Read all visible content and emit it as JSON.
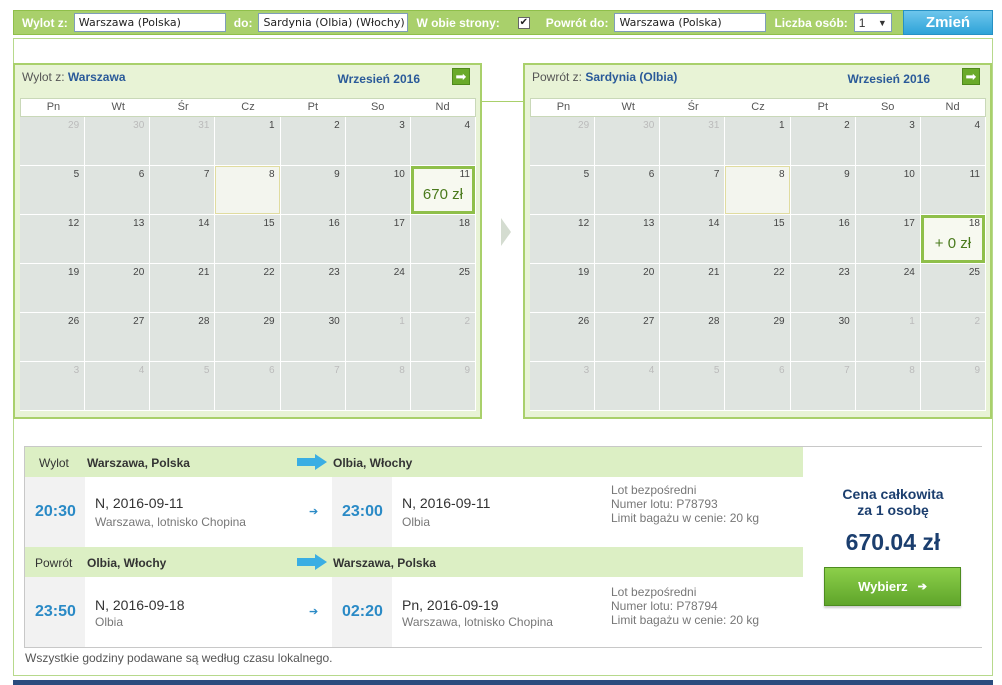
{
  "search": {
    "from_label": "Wylot z:",
    "from_value": "Warszawa (Polska)",
    "to_label": "do:",
    "to_value": "Sardynia (Olbia) (Włochy)",
    "both_ways_label": "W obie strony:",
    "both_ways_checked": "✔",
    "return_label": "Powrót do:",
    "return_value": "Warszawa (Polska)",
    "persons_label": "Liczba osób:",
    "persons_value": "1",
    "submit_label": "Zmień"
  },
  "weekdays": [
    "Pn",
    "Wt",
    "Śr",
    "Cz",
    "Pt",
    "So",
    "Nd"
  ],
  "outbound_calendar": {
    "title_prefix": "Wylot z:",
    "title_city": "Warszawa",
    "month": "Wrzesień 2016",
    "next_icon": "arrow-right-icon",
    "days": [
      {
        "n": "29",
        "muted": true
      },
      {
        "n": "30",
        "muted": true
      },
      {
        "n": "31",
        "muted": true
      },
      {
        "n": "1"
      },
      {
        "n": "2"
      },
      {
        "n": "3"
      },
      {
        "n": "4"
      },
      {
        "n": "5"
      },
      {
        "n": "6"
      },
      {
        "n": "7"
      },
      {
        "n": "8",
        "today": true
      },
      {
        "n": "9"
      },
      {
        "n": "10"
      },
      {
        "n": "11",
        "selected": true,
        "price": "670 zł"
      },
      {
        "n": "12"
      },
      {
        "n": "13"
      },
      {
        "n": "14"
      },
      {
        "n": "15"
      },
      {
        "n": "16"
      },
      {
        "n": "17"
      },
      {
        "n": "18"
      },
      {
        "n": "19"
      },
      {
        "n": "20"
      },
      {
        "n": "21"
      },
      {
        "n": "22"
      },
      {
        "n": "23"
      },
      {
        "n": "24"
      },
      {
        "n": "25"
      },
      {
        "n": "26"
      },
      {
        "n": "27"
      },
      {
        "n": "28"
      },
      {
        "n": "29"
      },
      {
        "n": "30"
      },
      {
        "n": "1",
        "muted": true
      },
      {
        "n": "2",
        "muted": true
      },
      {
        "n": "3",
        "muted": true
      },
      {
        "n": "4",
        "muted": true
      },
      {
        "n": "5",
        "muted": true
      },
      {
        "n": "6",
        "muted": true
      },
      {
        "n": "7",
        "muted": true
      },
      {
        "n": "8",
        "muted": true
      },
      {
        "n": "9",
        "muted": true
      }
    ]
  },
  "return_calendar": {
    "title_prefix": "Powrót z:",
    "title_city": "Sardynia (Olbia)",
    "month": "Wrzesień 2016",
    "next_icon": "arrow-right-icon",
    "days": [
      {
        "n": "29",
        "muted": true
      },
      {
        "n": "30",
        "muted": true
      },
      {
        "n": "31",
        "muted": true
      },
      {
        "n": "1"
      },
      {
        "n": "2"
      },
      {
        "n": "3"
      },
      {
        "n": "4"
      },
      {
        "n": "5"
      },
      {
        "n": "6"
      },
      {
        "n": "7"
      },
      {
        "n": "8",
        "today": true
      },
      {
        "n": "9"
      },
      {
        "n": "10"
      },
      {
        "n": "11"
      },
      {
        "n": "12"
      },
      {
        "n": "13"
      },
      {
        "n": "14"
      },
      {
        "n": "15"
      },
      {
        "n": "16"
      },
      {
        "n": "17"
      },
      {
        "n": "18",
        "selected": true,
        "price": "+ 0 zł"
      },
      {
        "n": "19"
      },
      {
        "n": "20"
      },
      {
        "n": "21"
      },
      {
        "n": "22"
      },
      {
        "n": "23"
      },
      {
        "n": "24"
      },
      {
        "n": "25"
      },
      {
        "n": "26"
      },
      {
        "n": "27"
      },
      {
        "n": "28"
      },
      {
        "n": "29"
      },
      {
        "n": "30"
      },
      {
        "n": "1",
        "muted": true
      },
      {
        "n": "2",
        "muted": true
      },
      {
        "n": "3",
        "muted": true
      },
      {
        "n": "4",
        "muted": true
      },
      {
        "n": "5",
        "muted": true
      },
      {
        "n": "6",
        "muted": true
      },
      {
        "n": "7",
        "muted": true
      },
      {
        "n": "8",
        "muted": true
      },
      {
        "n": "9",
        "muted": true
      }
    ]
  },
  "outbound": {
    "label": "Wylot",
    "from": "Warszawa, Polska",
    "to": "Olbia, Włochy",
    "dep_time": "20:30",
    "dep_day": "N,",
    "dep_date": "2016-09-11",
    "dep_airport": "Warszawa, lotnisko Chopina",
    "arr_time": "23:00",
    "arr_day": "N,",
    "arr_date": "2016-09-11",
    "arr_airport": "Olbia",
    "info1": "Lot bezpośredni",
    "info2": "Numer lotu: P78793",
    "info3": "Limit bagażu w cenie: 20 kg"
  },
  "inbound": {
    "label": "Powrót",
    "from": "Olbia, Włochy",
    "to": "Warszawa, Polska",
    "dep_time": "23:50",
    "dep_day": "N,",
    "dep_date": "2016-09-18",
    "dep_airport": "Olbia",
    "arr_time": "02:20",
    "arr_day": "Pn,",
    "arr_date": "2016-09-19",
    "arr_airport": "Warszawa, lotnisko Chopina",
    "info1": "Lot bezpośredni",
    "info2": "Numer lotu: P78794",
    "info3": "Limit bagażu w cenie: 20 kg"
  },
  "price": {
    "title_line1": "Cena całkowita",
    "title_line2": "za 1 osobę",
    "value": "670.04 zł",
    "button_label": "Wybierz"
  },
  "footnote": "Wszystkie godziny podawane są według czasu lokalnego.",
  "colors": {
    "accent_green": "#a9d06b",
    "time_blue": "#2a8ac6",
    "price_navy": "#1b3e6e",
    "button_blue": "#2ea3d8"
  }
}
